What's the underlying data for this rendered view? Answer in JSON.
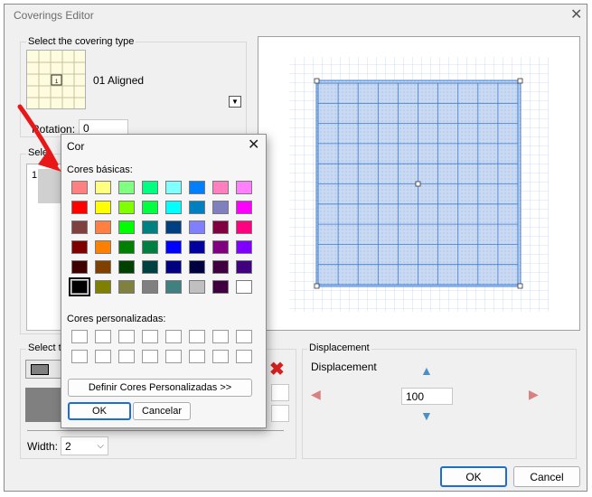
{
  "main": {
    "title": "Coverings Editor",
    "covering_group_label": "Select the covering type",
    "covering_name": "01 Aligned",
    "rotation_label": "Rotation:",
    "rotation_value": "0",
    "sel_group_label_partial": "Sele",
    "list_item_number": "1",
    "select_group_label_partial": "Select th",
    "width_label": "Width:",
    "width_value": "2",
    "displacement_group_label": "Displacement",
    "displacement_label": "Displacement",
    "displacement_value": "100",
    "ok_label": "OK",
    "cancel_label": "Cancel"
  },
  "color_dialog": {
    "title": "Cor",
    "basic_label": "Cores básicas:",
    "custom_label": "Cores personalizadas:",
    "define_label": "Definir Cores Personalizadas >>",
    "ok_label": "OK",
    "cancel_label": "Cancelar",
    "basic_colors": [
      "#ff8080",
      "#ffff80",
      "#80ff80",
      "#00ff80",
      "#80ffff",
      "#0080ff",
      "#ff80c0",
      "#ff80ff",
      "#ff0000",
      "#ffff00",
      "#80ff00",
      "#00ff40",
      "#00ffff",
      "#0080c0",
      "#8080c0",
      "#ff00ff",
      "#804040",
      "#ff8040",
      "#00ff00",
      "#008080",
      "#004080",
      "#8080ff",
      "#800040",
      "#ff0080",
      "#800000",
      "#ff8000",
      "#008000",
      "#008040",
      "#0000ff",
      "#0000a0",
      "#800080",
      "#8000ff",
      "#400000",
      "#804000",
      "#004000",
      "#004040",
      "#000080",
      "#000040",
      "#400040",
      "#400080",
      "#000000",
      "#808000",
      "#808040",
      "#808080",
      "#408080",
      "#c0c0c0",
      "#400040",
      "#ffffff"
    ],
    "selected_index": 40
  },
  "colors": {
    "selected_swatch": "#808080",
    "preview_fill": "#c9d9f2",
    "grid_line": "#3d7fd1",
    "arrow_blue": "#4a90c8",
    "arrow_red": "#d98080",
    "delete_red": "#d42020",
    "annotation_arrow": "#e81818"
  }
}
